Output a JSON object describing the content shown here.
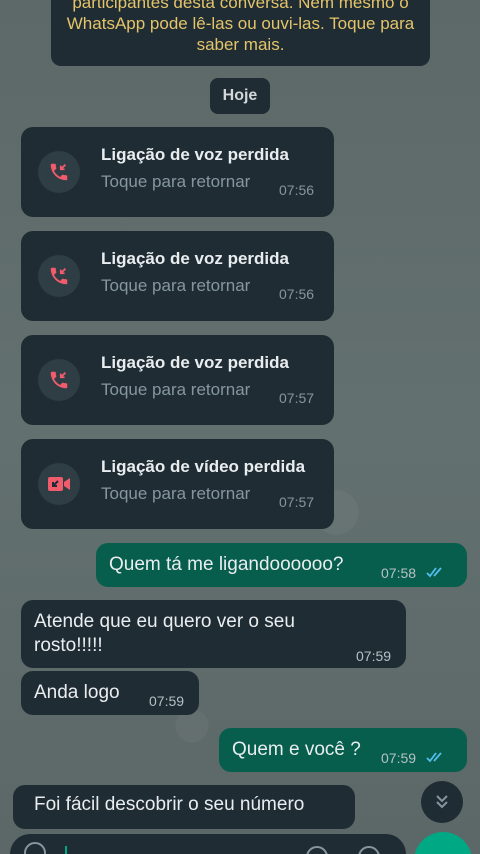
{
  "encryption_notice": {
    "line1": "participantes desta conversa. Nem mesmo o",
    "line2": "WhatsApp pode lê-las ou ouvi-las. Toque para",
    "line3": "saber mais."
  },
  "date_chip": "Hoje",
  "calls": [
    {
      "title": "Ligação de voz perdida",
      "subtitle": "Toque para retornar",
      "time": "07:56",
      "icon": "missed-voice-call-icon"
    },
    {
      "title": "Ligação de voz perdida",
      "subtitle": "Toque para retornar",
      "time": "07:56",
      "icon": "missed-voice-call-icon"
    },
    {
      "title": "Ligação de voz perdida",
      "subtitle": "Toque para retornar",
      "time": "07:57",
      "icon": "missed-voice-call-icon"
    },
    {
      "title": "Ligação de vídeo perdida",
      "subtitle": "Toque para retornar",
      "time": "07:57",
      "icon": "missed-video-call-icon"
    }
  ],
  "messages": [
    {
      "direction": "out",
      "lines": [
        "Quem tá me ligandoooooo?"
      ],
      "time": "07:58",
      "status": "read"
    },
    {
      "direction": "in",
      "lines": [
        "Atende que eu quero ver o seu",
        "rosto!!!!!"
      ],
      "time": "07:59"
    },
    {
      "direction": "in",
      "lines": [
        "Anda logo"
      ],
      "time": "07:59"
    },
    {
      "direction": "out",
      "lines": [
        "Quem e você ?"
      ],
      "time": "07:59",
      "status": "read"
    },
    {
      "direction": "in",
      "lines": [
        "Foi fácil descobrir o seu número"
      ],
      "time": ""
    }
  ],
  "colors": {
    "incoming_bubble": "#1f2c33",
    "outgoing_bubble": "#075e4d",
    "missed_call": "#f15c6d",
    "read_ticks": "#53bdeb",
    "notice_text": "#e4c46a",
    "accent": "#00a884"
  }
}
